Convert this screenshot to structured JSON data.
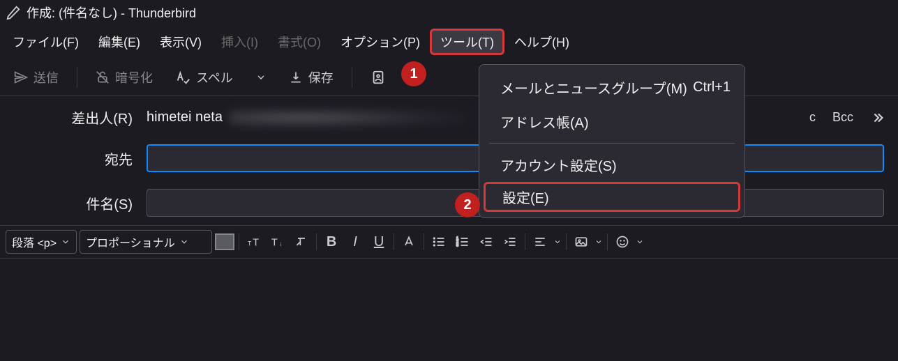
{
  "window": {
    "title": "作成: (件名なし) - Thunderbird"
  },
  "menubar": {
    "file": "ファイル(F)",
    "edit": "編集(E)",
    "view": "表示(V)",
    "insert": "挿入(I)",
    "format": "書式(O)",
    "options": "オプション(P)",
    "tools": "ツール(T)",
    "help": "ヘルプ(H)"
  },
  "toolbar": {
    "send": "送信",
    "encrypt": "暗号化",
    "spell": "スペル",
    "save": "保存"
  },
  "headers": {
    "from_label": "差出人(R)",
    "from_value": "himetei neta",
    "to_label": "宛先",
    "subject_label": "件名(S)",
    "cc": "c",
    "bcc": "Bcc"
  },
  "formatbar": {
    "paragraph": "段落 <p>",
    "font": "プロポーショナル"
  },
  "context_menu": {
    "mail_news": {
      "label": "メールとニュースグループ(M)",
      "shortcut": "Ctrl+1"
    },
    "address_book": {
      "label": "アドレス帳(A)"
    },
    "account_settings": {
      "label": "アカウント設定(S)"
    },
    "settings": {
      "label": "設定(E)"
    }
  },
  "annotations": {
    "one": "1",
    "two": "2"
  }
}
